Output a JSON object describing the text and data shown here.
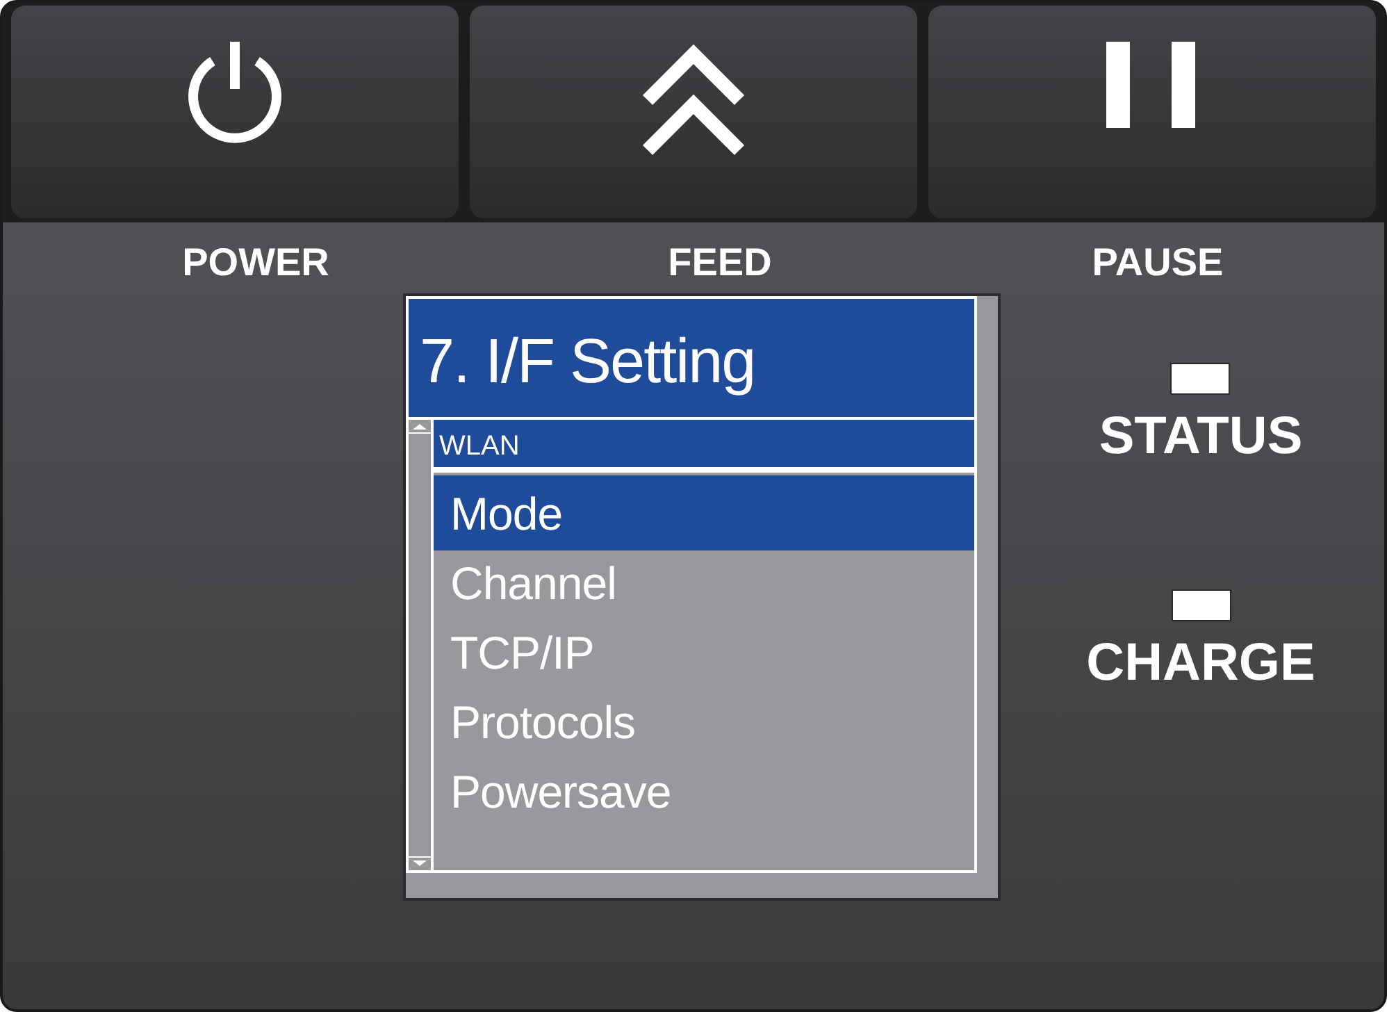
{
  "buttons": [
    {
      "kind": "power",
      "label": "POWER"
    },
    {
      "kind": "feed",
      "label": "FEED"
    },
    {
      "kind": "pause",
      "label": "PAUSE"
    }
  ],
  "display": {
    "title": "7. I/F Setting",
    "section": "WLAN",
    "items": [
      {
        "label": "Mode",
        "selected": true
      },
      {
        "label": "Channel",
        "selected": false
      },
      {
        "label": "TCP/IP",
        "selected": false
      },
      {
        "label": "Protocols",
        "selected": false
      },
      {
        "label": "Powersave",
        "selected": false
      }
    ]
  },
  "indicators": [
    {
      "label": "STATUS"
    },
    {
      "label": "CHARGE"
    }
  ]
}
